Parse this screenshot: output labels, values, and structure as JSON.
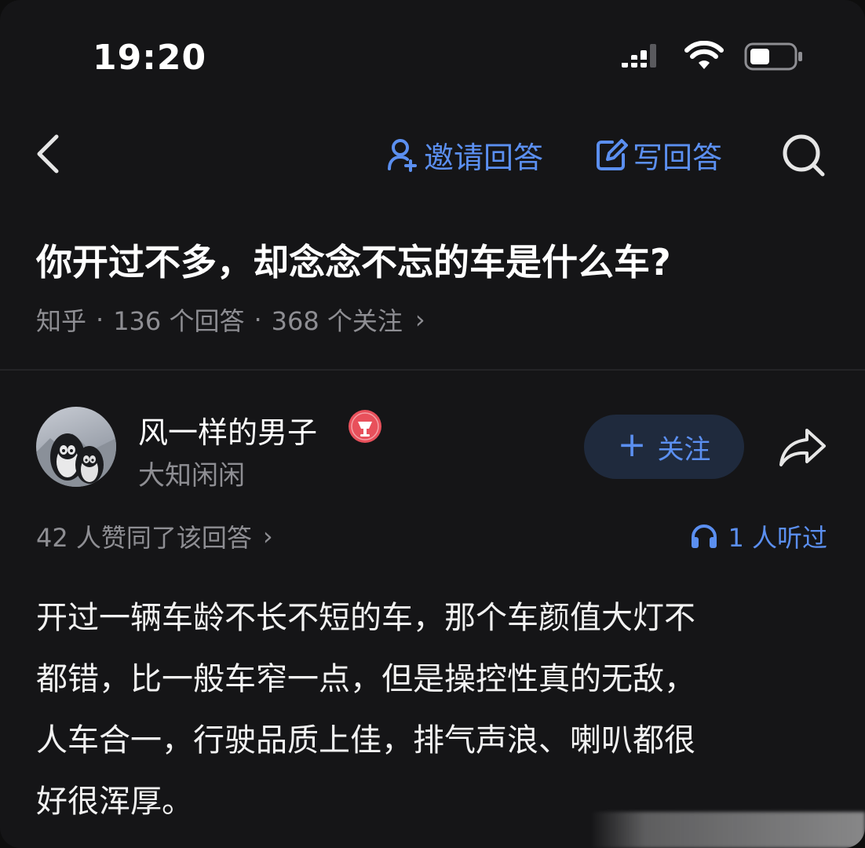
{
  "status_bar": {
    "time": "19:20",
    "icons": [
      "cellular-signal-icon",
      "wifi-icon",
      "battery-icon"
    ]
  },
  "nav": {
    "invite_label": "邀请回答",
    "write_label": "写回答",
    "icons": [
      "back-icon",
      "invite-user-icon",
      "edit-icon",
      "search-icon"
    ]
  },
  "question": {
    "title": "你开过不多，却念念不忘的车是什么车?",
    "source": "知乎",
    "answers": "136 个回答",
    "followers": "368 个关注",
    "chevron": "›"
  },
  "author": {
    "name": "风一样的男子",
    "bio": "大知闲闲",
    "follow_label": "关注",
    "follow_plus": "+"
  },
  "answer": {
    "votes": "42 人赞同了该回答",
    "votes_chevron": "›",
    "listened": "1 人听过",
    "lines": [
      "开过一辆车龄不长不短的车，那个车颜值大灯不",
      "都错，比一般车窄一点，但是操控性真的无敌，",
      "人车合一，行驶品质上佳，排气声浪、喇叭都很",
      "好很浑厚。"
    ]
  },
  "colors": {
    "background": "#151517",
    "accent": "#5b8ff0",
    "secondary_text": "#8e8e93",
    "follow_bg": "#1f2a3d",
    "badge_red": "#e8505b"
  }
}
